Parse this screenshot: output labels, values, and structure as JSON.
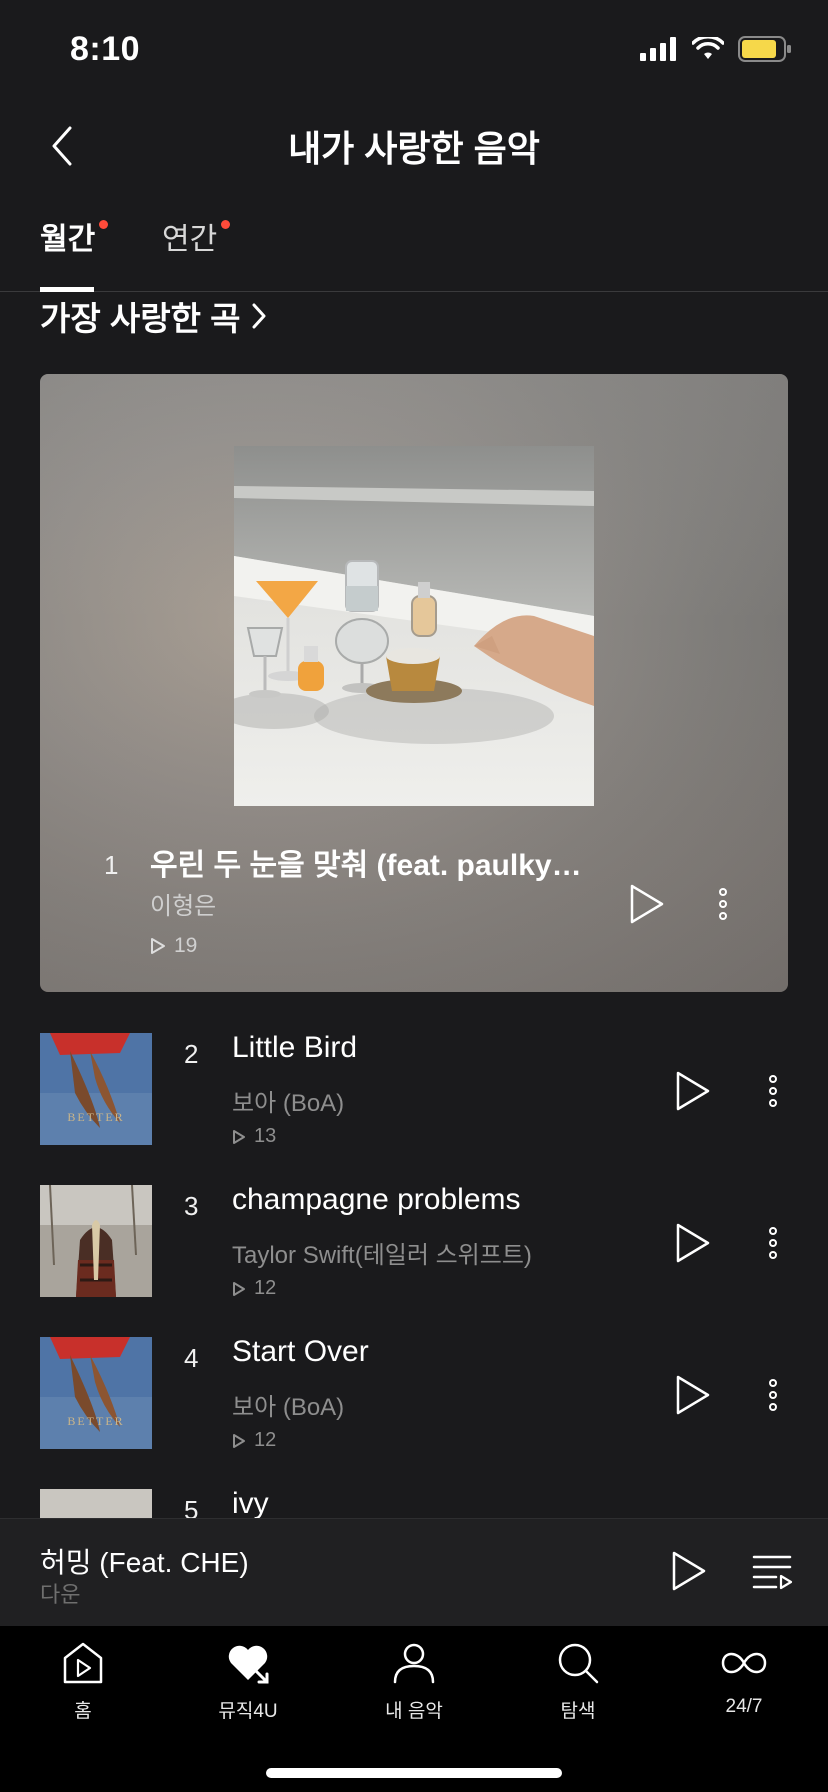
{
  "status_bar": {
    "time": "8:10"
  },
  "header": {
    "title": "내가 사랑한 음악"
  },
  "tabs": [
    {
      "label": "월간",
      "has_dot": true,
      "active": true
    },
    {
      "label": "연간",
      "has_dot": true,
      "active": false
    }
  ],
  "section": {
    "title": "가장 사랑한 곡"
  },
  "top_track": {
    "rank": "1",
    "title": "우린 두 눈을 맞춰 (feat. paulky…",
    "artist": "이형은",
    "plays": "19"
  },
  "tracks": [
    {
      "rank": "2",
      "title": "Little Bird",
      "artist": "보아 (BoA)",
      "plays": "13"
    },
    {
      "rank": "3",
      "title": "champagne problems",
      "artist": "Taylor Swift(테일러 스위프트)",
      "plays": "12"
    },
    {
      "rank": "4",
      "title": "Start Over",
      "artist": "보아 (BoA)",
      "plays": "12"
    },
    {
      "rank": "5",
      "title": "ivy"
    }
  ],
  "mini_player": {
    "title": "허밍 (Feat. CHE)",
    "artist": "다운"
  },
  "tabbar": [
    {
      "label": "홈",
      "icon": "home-play-icon"
    },
    {
      "label": "뮤직4U",
      "icon": "heart-arrow-icon"
    },
    {
      "label": "내 음악",
      "icon": "person-icon"
    },
    {
      "label": "탐색",
      "icon": "search-icon"
    },
    {
      "label": "24/7",
      "icon": "infinity-loop-icon"
    }
  ],
  "colors": {
    "accent_dot": "#ff4b3a",
    "background": "#1a1a1c",
    "battery": "#f6d84a"
  }
}
